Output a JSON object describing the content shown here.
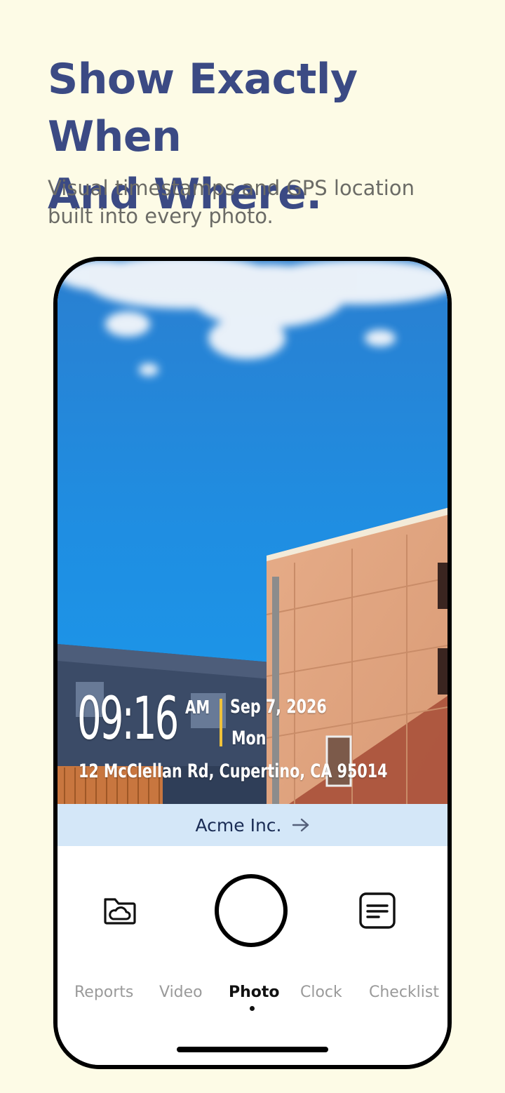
{
  "headline": {
    "line1": "Show Exactly When",
    "line2": "And Where."
  },
  "subhead": {
    "line1": "Visual timestamps and GPS location",
    "line2": "built into every photo."
  },
  "stamp": {
    "time": "09:16",
    "ampm": "AM",
    "date": "Sep 7, 2026",
    "day": "Mon",
    "address": "12 McClellan Rd, Cupertino, CA 95014",
    "accent_color": "#f0c23a"
  },
  "company_bar": {
    "label": "Acme Inc.",
    "arrow_icon": "arrow-right-icon"
  },
  "controls": {
    "left_icon": "folder-cloud-icon",
    "right_icon": "notes-icon"
  },
  "modes": [
    "Reports",
    "Video",
    "Photo",
    "Clock",
    "Checklist"
  ],
  "active_mode": "Photo",
  "colors": {
    "background": "#fdfbe6",
    "headline": "#3b4a84",
    "company_bar": "#d4e7f8"
  }
}
